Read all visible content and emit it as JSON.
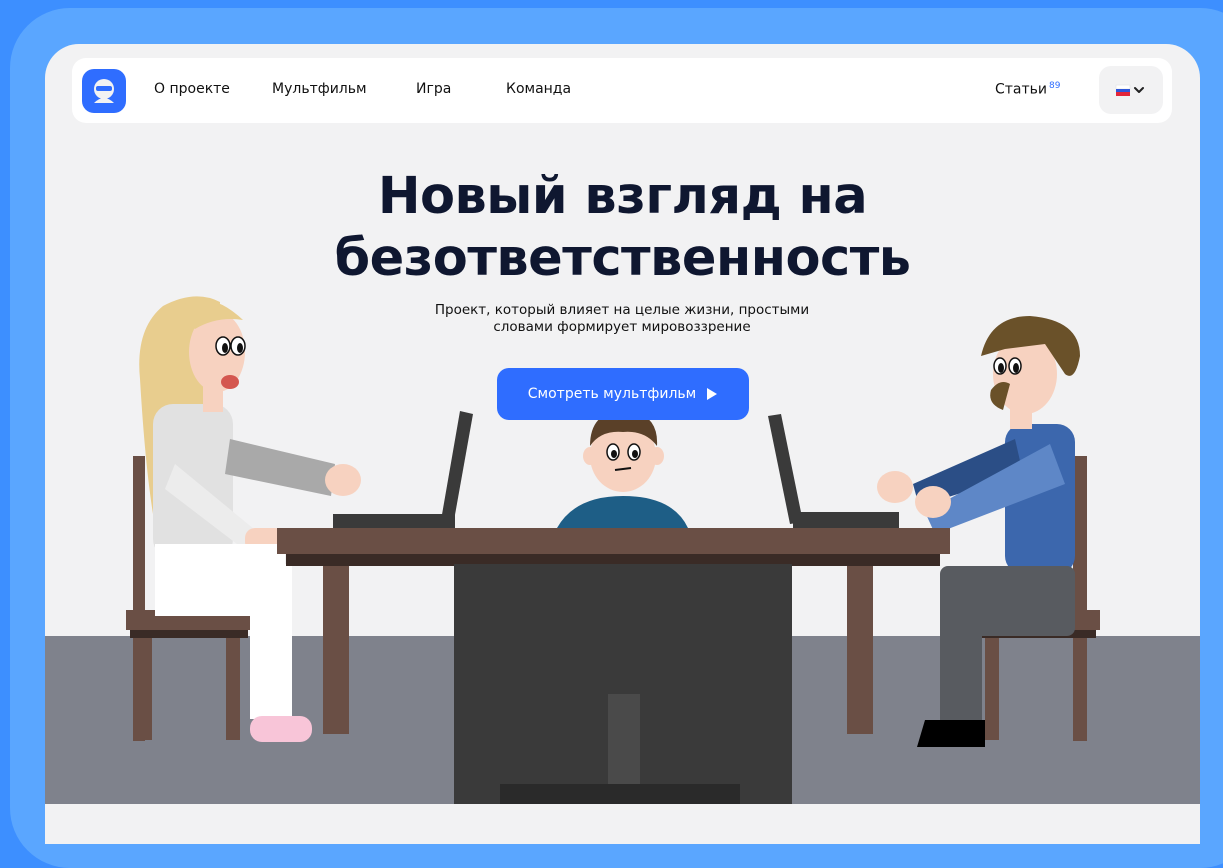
{
  "nav": {
    "links": [
      "О проекте",
      "Мультфильм",
      "Игра",
      "Команда"
    ],
    "articles_label": "Статьи",
    "articles_count": "89",
    "language": "ru"
  },
  "hero": {
    "title_line1": "Новый взгляд на",
    "title_line2": "безответственность",
    "subtitle": "Проект, который влияет на целые жизни, простыми словами формирует мировоззрение",
    "cta_label": "Смотреть мультфильм"
  },
  "colors": {
    "accent": "#2f6dff",
    "background_outer": "#3d8fff",
    "page": "#f2f2f3",
    "title": "#0f1730"
  }
}
